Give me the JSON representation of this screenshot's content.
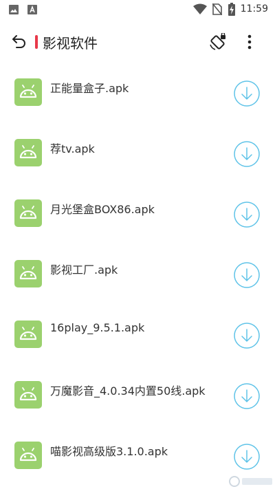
{
  "status_bar": {
    "time": "11:59",
    "icons": [
      "image-icon",
      "a-icon",
      "wifi-icon",
      "no-sim-icon",
      "battery-charging-icon"
    ]
  },
  "app_bar": {
    "back_icon": "back-arrow-icon",
    "title": "影视软件",
    "accent_color": "#e8394a",
    "actions": [
      "screen-rotation-lock-icon",
      "more-vert-icon"
    ]
  },
  "files": [
    {
      "name": "正能量盒子.apk"
    },
    {
      "name": "荐tv.apk"
    },
    {
      "name": "月光堡盒BOX86.apk"
    },
    {
      "name": "影视工厂.apk"
    },
    {
      "name": "16play_9.5.1.apk"
    },
    {
      "name": "万魔影音_4.0.34内置50线.apk"
    },
    {
      "name": "喵影视高级版3.1.0.apk"
    }
  ],
  "colors": {
    "android_icon_bg": "#9bd16e",
    "download_accent": "#5ec3e8"
  }
}
